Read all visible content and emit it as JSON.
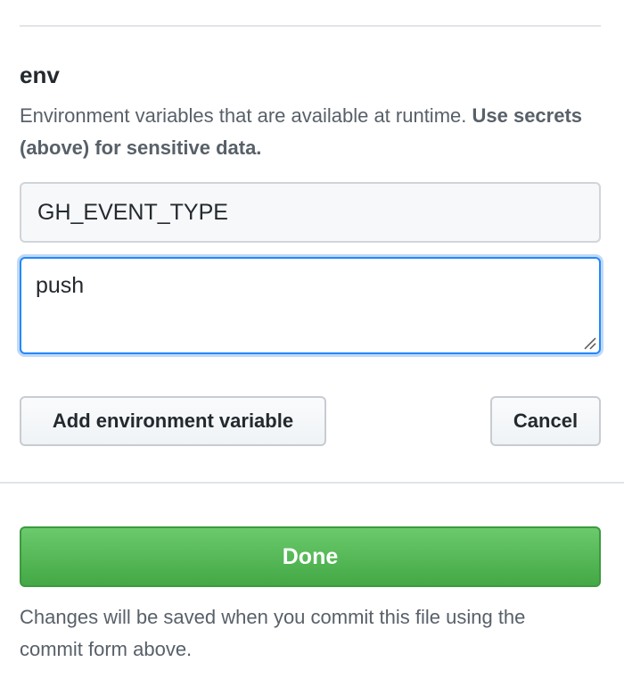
{
  "env_section": {
    "title": "env",
    "description": "Environment variables that are available at runtime. ",
    "description_emphasis": "Use secrets (above) for sensitive data.",
    "name_input_value": "GH_EVENT_TYPE",
    "value_input_value": "push"
  },
  "actions": {
    "add_label": "Add environment variable",
    "cancel_label": "Cancel"
  },
  "footer": {
    "done_label": "Done",
    "note": "Changes will be saved when you commit this file using the commit form above."
  },
  "colors": {
    "focus_border": "#2188ff",
    "done_green": "#4eb450",
    "text_muted": "#586069"
  }
}
